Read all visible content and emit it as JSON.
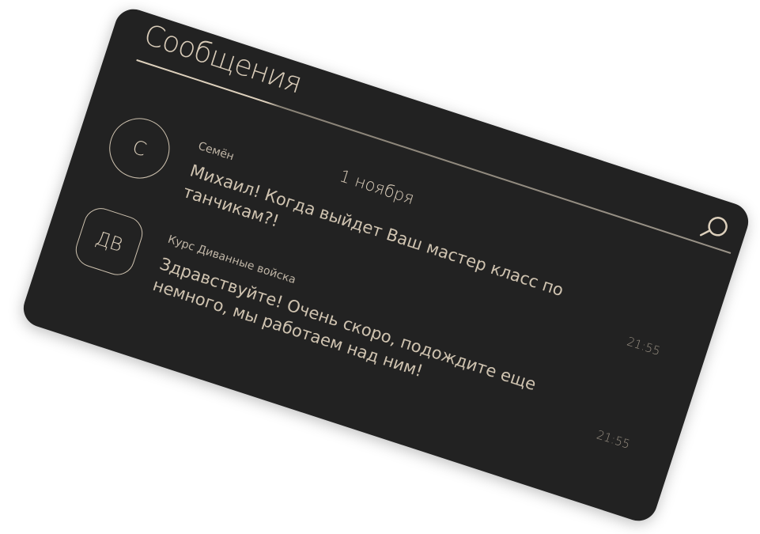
{
  "header": {
    "title": "Сообщения"
  },
  "date_divider": "1 ноября",
  "messages": [
    {
      "avatar_initials": "С",
      "sender": "Семён",
      "text": "Михаил! Когда выйдет Ваш мастер класс по танчикам?!",
      "time": "21:55"
    },
    {
      "avatar_initials": "ДВ",
      "sender": "Курс Диванные войска",
      "text": "Здравствуйте! Очень скоро, подождите еще немного, мы работаем над ним!",
      "time": "21:55"
    }
  ],
  "icons": {
    "search": "search-icon"
  },
  "colors": {
    "card_background": "#222222",
    "accent": "#d9ccb9",
    "page_background": "#ffffff"
  }
}
